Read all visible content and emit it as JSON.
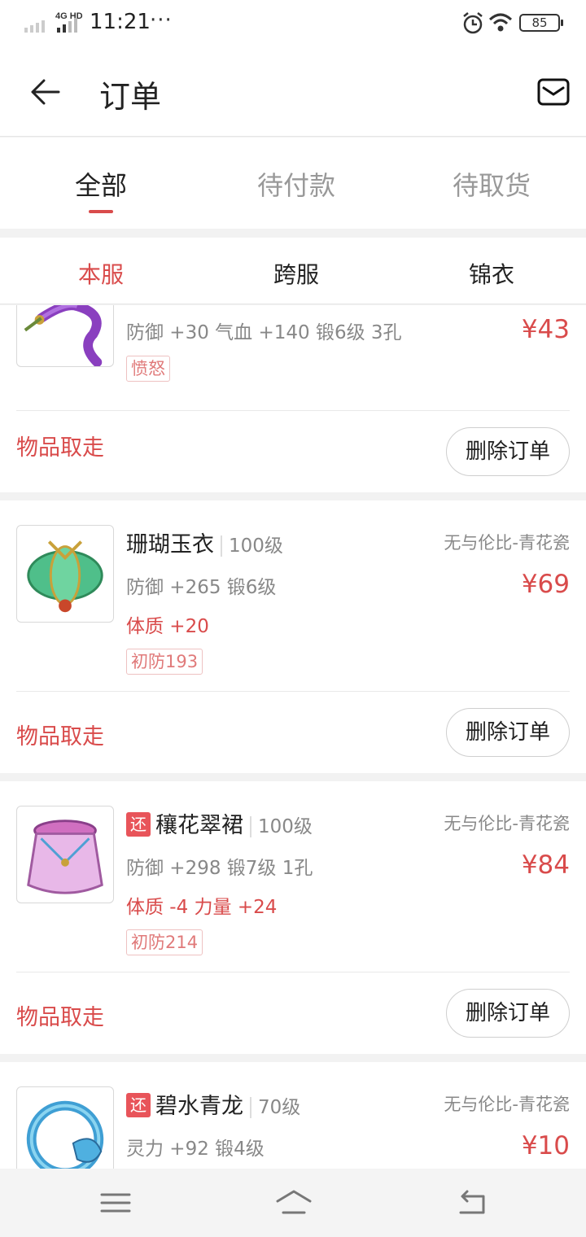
{
  "status_bar": {
    "network": "4G HD",
    "time": "11:21",
    "more": "···",
    "battery": "85",
    "icons": [
      "signal-icon",
      "alarm-icon",
      "wifi-icon",
      "battery-icon"
    ]
  },
  "header": {
    "title": "订单",
    "back_icon": "arrow-left-icon",
    "message_icon": "mail-icon"
  },
  "tabs": [
    {
      "label": "全部",
      "active": true
    },
    {
      "label": "待付款",
      "active": false
    },
    {
      "label": "待取货",
      "active": false
    }
  ],
  "subtabs": [
    {
      "label": "本服",
      "active": true
    },
    {
      "label": "跨服",
      "active": false
    },
    {
      "label": "锦衣",
      "active": false
    }
  ],
  "orders": [
    {
      "stats": "防御 +30 气血 +140  锻6级  3孔",
      "tag": "愤怒",
      "price": "¥43",
      "status": "物品取走",
      "action": "删除订单"
    },
    {
      "name": "珊瑚玉衣",
      "level": "100级",
      "server": "无与伦比-青花瓷",
      "stats": "防御 +265  锻6级",
      "bonus": "体质 +20",
      "tag": "初防193",
      "price": "¥69",
      "status": "物品取走",
      "action": "删除订单"
    },
    {
      "return_tag": "还",
      "name": "穰花翠裙",
      "level": "100级",
      "server": "无与伦比-青花瓷",
      "stats": "防御 +298  锻7级  1孔",
      "bonus": "体质 -4 力量 +24",
      "tag": "初防214",
      "price": "¥84",
      "status": "物品取走",
      "action": "删除订单"
    },
    {
      "return_tag": "还",
      "name": "碧水青龙",
      "level": "70级",
      "server": "无与伦比-青花瓷",
      "stats": "灵力 +92  锻4级",
      "price": "¥10"
    }
  ],
  "nav_bar": {
    "icons": [
      "menu-icon",
      "home-icon",
      "back-icon"
    ]
  },
  "colors": {
    "accent": "#d94b4b",
    "return_tag": "#e8545a",
    "muted_text": "#888888"
  }
}
